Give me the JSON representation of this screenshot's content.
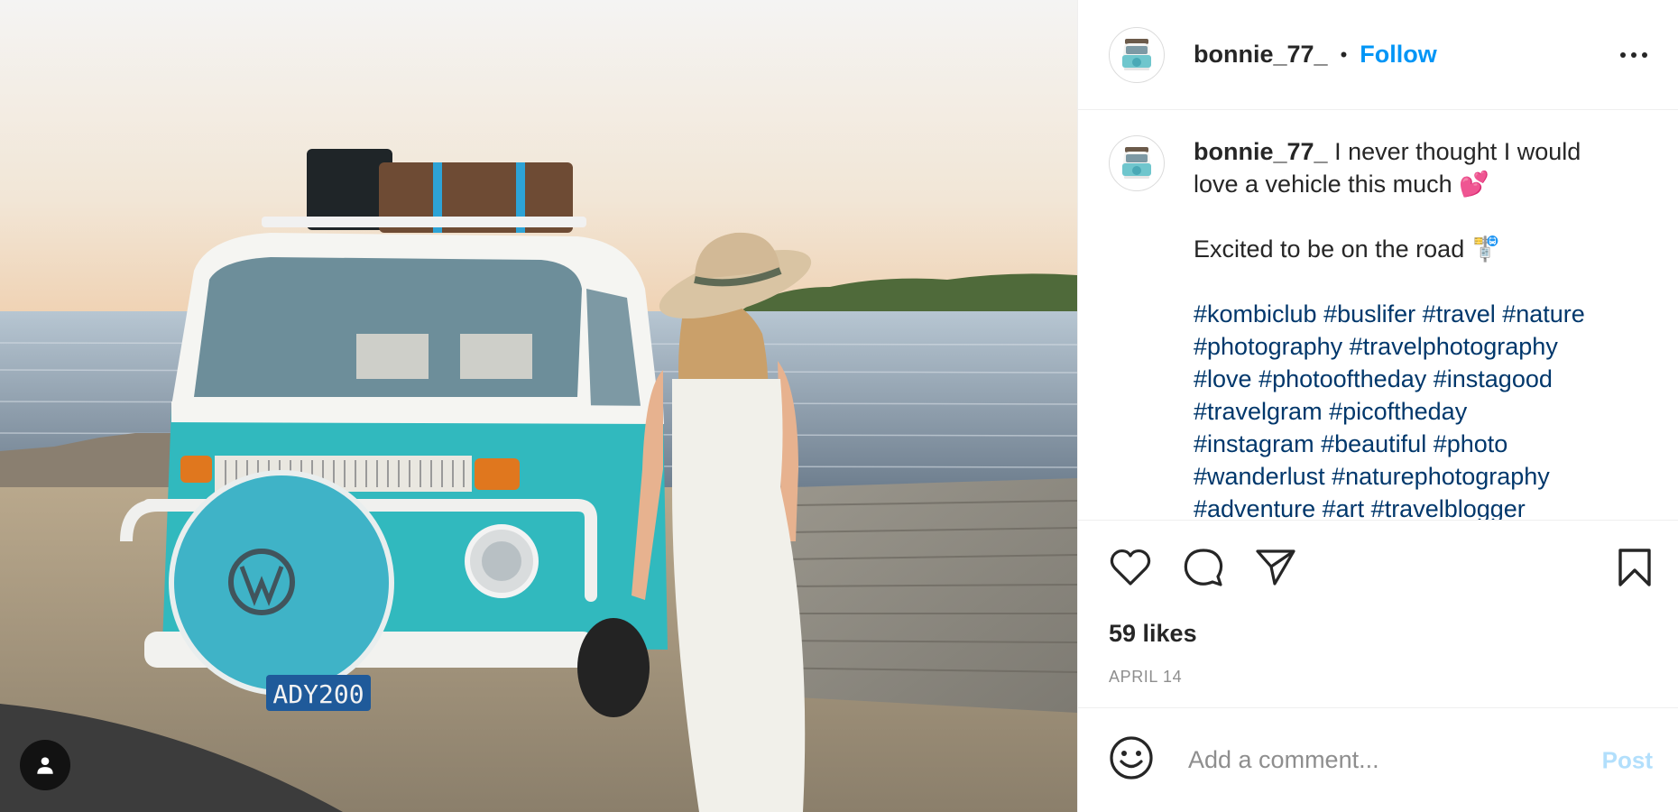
{
  "post": {
    "author": {
      "username": "bonnie_77_",
      "follow_label": "Follow",
      "separator": "•"
    },
    "caption": {
      "username": "bonnie_77_",
      "line1": "I never thought I would love a vehicle this much 💕",
      "line2": "Excited to be on the road 🚏",
      "hashtags": [
        "#kombiclub",
        "#buslifer",
        "#travel",
        "#nature",
        "#photography",
        "#travelphotography",
        "#love",
        "#photooftheday",
        "#instagood",
        "#travelgram",
        "#picoftheday",
        "#instagram",
        "#beautiful",
        "#photo",
        "#wanderlust",
        "#naturephotography",
        "#adventure",
        "#art",
        "#travelblogger"
      ]
    },
    "likes_text": "59 likes",
    "date_text": "APRIL 14",
    "comment": {
      "placeholder": "Add a comment...",
      "post_label": "Post"
    },
    "photo": {
      "license_plate": "ADY200"
    }
  },
  "icons": {
    "like": "heart-icon",
    "comment": "comment-bubble-icon",
    "share": "paper-plane-icon",
    "save": "bookmark-icon",
    "more": "more-dots-icon",
    "emoji": "smiley-icon",
    "tags": "user-tag-icon"
  },
  "colors": {
    "follow": "#0095f6",
    "hashtag": "#00376b",
    "post_disabled": "#b2dffc",
    "muted": "#8e8e8e"
  }
}
